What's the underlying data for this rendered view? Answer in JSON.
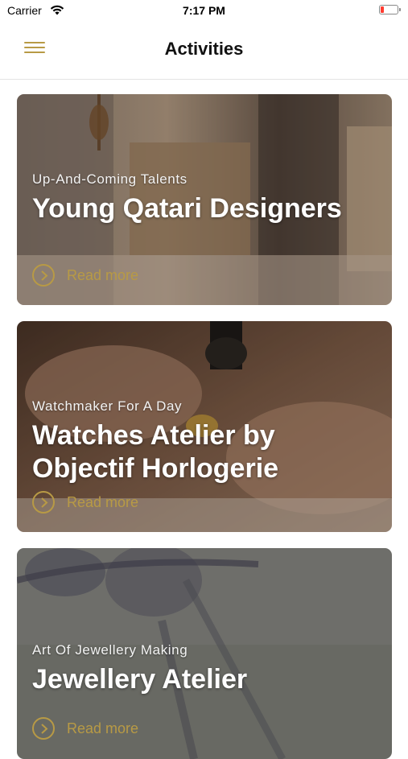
{
  "status_bar": {
    "carrier": "Carrier",
    "time": "7:17 PM",
    "battery_color": "#ff3b30"
  },
  "nav": {
    "title": "Activities",
    "menu_icon": "hamburger-menu-icon",
    "accent_color": "#b89a45"
  },
  "cards": [
    {
      "subtitle": "Up-And-Coming Talents",
      "title": "Young Qatari Designers",
      "read_more": "Read more",
      "image": "boutique-interior-photo"
    },
    {
      "subtitle": "Watchmaker For A Day",
      "title": "Watches Atelier by Objectif Horlogerie",
      "read_more": "Read more",
      "image": "watchmaker-hands-photo"
    },
    {
      "subtitle": "Art Of Jewellery Making",
      "title": "Jewellery Atelier",
      "read_more": "Read more",
      "image": "jewellery-sketch-photo"
    }
  ]
}
